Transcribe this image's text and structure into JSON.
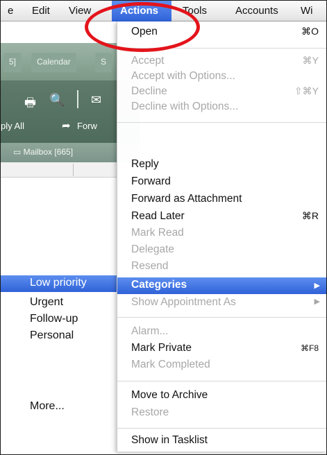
{
  "menubar": {
    "items": [
      "e",
      "Edit",
      "View",
      "Actions",
      "Tools",
      "Accounts",
      "Wi"
    ]
  },
  "background": {
    "tabs": [
      "5]",
      "Calendar",
      "S"
    ],
    "toolbar": {
      "reply_all": "ply All",
      "forward": "Forw"
    },
    "folder": "Mailbox [665]"
  },
  "actions_menu": {
    "items": [
      {
        "label": "Open",
        "shortcut": "⌘O",
        "enabled": true
      },
      {
        "label": "Accept",
        "shortcut": "⌘Y",
        "enabled": false
      },
      {
        "label": "Accept with Options...",
        "shortcut": "",
        "enabled": false
      },
      {
        "label": "Decline",
        "shortcut": "⇧⌘Y",
        "enabled": false
      },
      {
        "label": "Decline with Options...",
        "shortcut": "",
        "enabled": false
      },
      {
        "label": "Reply",
        "shortcut": "",
        "enabled": true
      },
      {
        "label": "Forward",
        "shortcut": "",
        "enabled": true
      },
      {
        "label": "Forward as Attachment",
        "shortcut": "",
        "enabled": true
      },
      {
        "label": "Read Later",
        "shortcut": "⌘R",
        "enabled": true
      },
      {
        "label": "Mark Read",
        "shortcut": "",
        "enabled": false
      },
      {
        "label": "Delegate",
        "shortcut": "",
        "enabled": false
      },
      {
        "label": "Resend",
        "shortcut": "",
        "enabled": false
      },
      {
        "label": "Categories",
        "shortcut": "▶",
        "enabled": true,
        "selected": true
      },
      {
        "label": "Show Appointment As",
        "shortcut": "▶",
        "enabled": false
      },
      {
        "label": "Alarm...",
        "shortcut": "",
        "enabled": false
      },
      {
        "label": "Mark Private",
        "shortcut": "⌘F8",
        "enabled": true
      },
      {
        "label": "Mark Completed",
        "shortcut": "",
        "enabled": false
      },
      {
        "label": "Move to Archive",
        "shortcut": "",
        "enabled": true
      },
      {
        "label": "Restore",
        "shortcut": "",
        "enabled": false
      },
      {
        "label": "Show in Tasklist",
        "shortcut": "",
        "enabled": true
      }
    ]
  },
  "categories_submenu": {
    "items": [
      "Low priority",
      "Urgent",
      "Follow-up",
      "Personal",
      "More..."
    ],
    "selected": "Low priority"
  },
  "colors": {
    "highlight_blue": "#2f62d8",
    "annotation_red": "#e3141b",
    "disabled_text": "#a8a8a8"
  }
}
